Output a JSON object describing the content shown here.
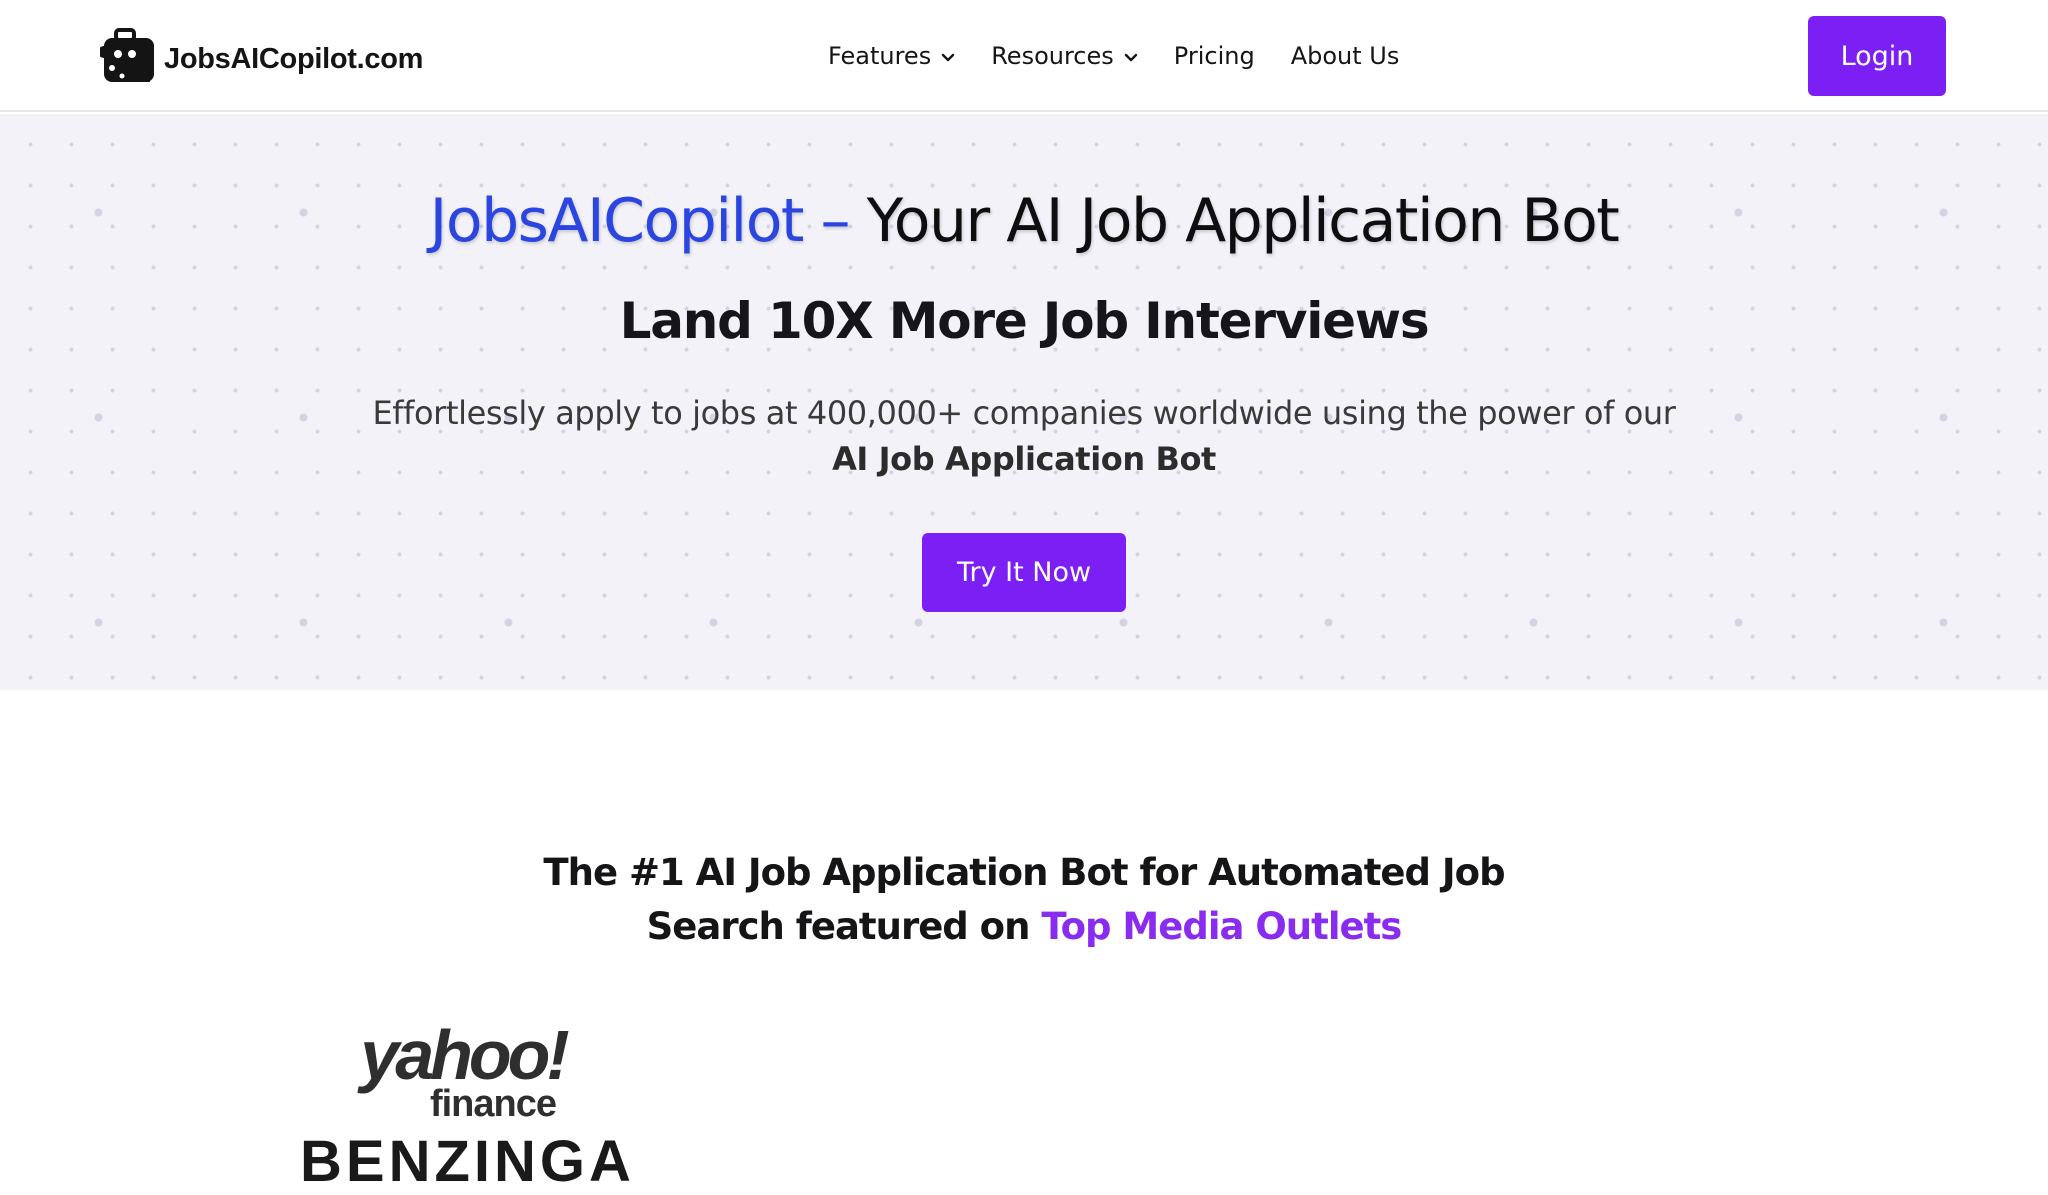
{
  "navbar": {
    "brand": "JobsAICopilot.com",
    "items": [
      {
        "label": "Features",
        "has_dropdown": true
      },
      {
        "label": "Resources",
        "has_dropdown": true
      },
      {
        "label": "Pricing",
        "has_dropdown": false
      },
      {
        "label": "About Us",
        "has_dropdown": false
      }
    ],
    "login_label": "Login"
  },
  "hero": {
    "title_accent": "JobsAICopilot –",
    "title_rest": " Your AI Job Application Bot",
    "subtitle": "Land 10X More Job Interviews",
    "description": "Effortlessly apply to jobs at 400,000+ companies worldwide using the power of our",
    "description_bold": "AI Job Application Bot",
    "cta_label": "Try It Now"
  },
  "featured": {
    "heading_line1": "The #1 AI Job Application Bot for Automated Job",
    "heading_line2": "Search featured on ",
    "heading_accent": "Top Media Outlets",
    "logos": [
      {
        "name": "yahoo-finance",
        "line1": "yahoo!",
        "line2": "finance"
      },
      {
        "name": "benzinga",
        "line1": "BENZINGA"
      }
    ]
  },
  "colors": {
    "accent_purple": "#7b1ff5",
    "title_blue": "#2b45e0",
    "heading_purple": "#8a2cf0",
    "hero_bg": "#f3f2f9"
  }
}
